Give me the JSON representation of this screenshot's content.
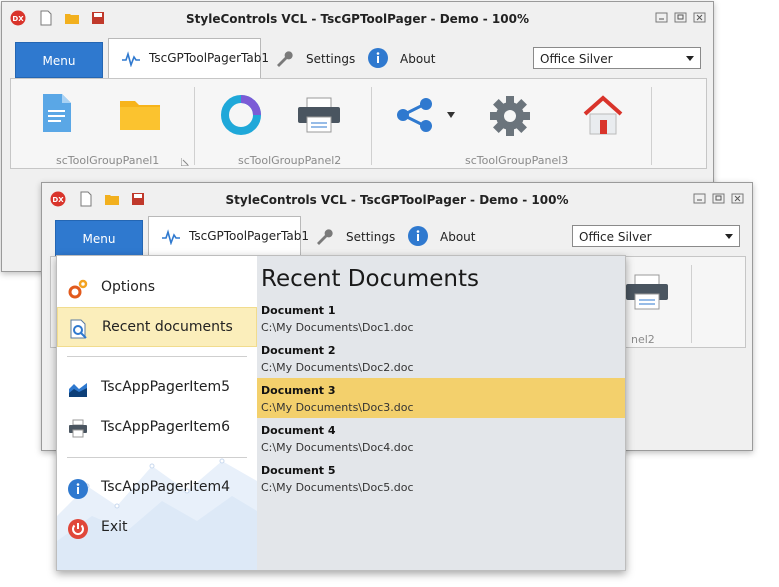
{
  "window_back": {
    "title": "StyleControls VCL - TscGPToolPager - Demo - 100%",
    "menu_label": "Menu",
    "tab_label": "TscGPToolPagerTab1",
    "settings_label": "Settings",
    "about_label": "About",
    "style_combo": "Office Silver",
    "groups": [
      "scToolGroupPanel1",
      "scToolGroupPanel2",
      "scToolGroupPanel3"
    ]
  },
  "window_front": {
    "title": "StyleControls VCL - TscGPToolPager - Demo - 100%",
    "menu_label": "Menu",
    "tab_label": "TscGPToolPagerTab1",
    "settings_label": "Settings",
    "about_label": "About",
    "style_combo": "Office Silver",
    "partial_group_label": "nel2"
  },
  "app_menu": {
    "items": [
      {
        "label": "Options",
        "icon": "gears-icon"
      },
      {
        "label": "Recent documents",
        "icon": "document-search-icon"
      },
      {
        "label": "TscAppPagerItem5",
        "icon": "chart-icon"
      },
      {
        "label": "TscAppPagerItem6",
        "icon": "printer-icon"
      },
      {
        "label": "TscAppPagerItem4",
        "icon": "info-icon"
      },
      {
        "label": "Exit",
        "icon": "power-icon"
      }
    ],
    "recent_title": "Recent Documents",
    "documents": [
      {
        "name": "Document 1",
        "path": "C:\\My Documents\\Doc1.doc"
      },
      {
        "name": "Document 2",
        "path": "C:\\My Documents\\Doc2.doc"
      },
      {
        "name": "Document 3",
        "path": "C:\\My Documents\\Doc3.doc"
      },
      {
        "name": "Document 4",
        "path": "C:\\My Documents\\Doc4.doc"
      },
      {
        "name": "Document 5",
        "path": "C:\\My Documents\\Doc5.doc"
      }
    ]
  },
  "colors": {
    "accent": "#2f79cf",
    "selection": "#f3d06c",
    "exit_red": "#e0473a"
  }
}
